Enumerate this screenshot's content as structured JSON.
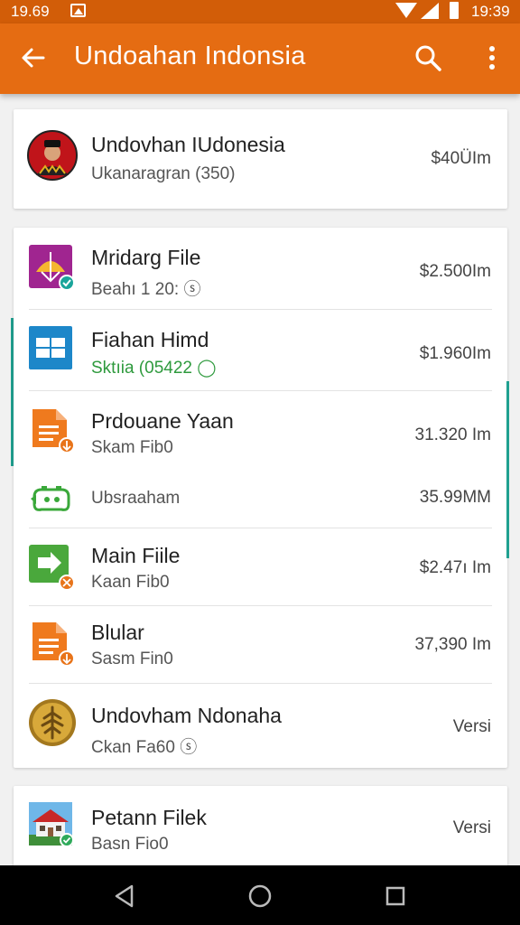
{
  "status_bar": {
    "time": "19.69",
    "clock": "19:39",
    "icons": [
      "notification-icon",
      "signal-icon",
      "network-icon",
      "battery-icon"
    ]
  },
  "app_bar": {
    "title": "Undoahan Indonsia",
    "icons": [
      "back-arrow-icon",
      "search-icon",
      "more-vert-icon"
    ]
  },
  "header_card": {
    "title": "Undovhan IUdonesia",
    "subtitle": "Ukanaragran (350)",
    "size": "$40ÜIm",
    "icon": "avatar-icon"
  },
  "file_list": [
    {
      "title": "Mridarg File",
      "subtitle": "Beahı 1 20: ⓢ",
      "size": "$2.500Im",
      "icon": "mridarg-app-icon",
      "badge": "check-badge-icon",
      "subtitle_color": "#555555"
    },
    {
      "title": "Fiahan Himd",
      "subtitle": "Sktıia (05422 ◯",
      "size": "$1.960Im",
      "icon": "windows-app-icon",
      "badge": "",
      "subtitle_color": "#2e9a3d"
    },
    {
      "title": "Prdouane Yaan",
      "subtitle": "Skam Fib0",
      "size": "31.320 Im",
      "icon": "document-icon",
      "badge": "download-badge-icon",
      "subtitle_color": "#555555"
    },
    {
      "title": "",
      "subtitle": "Ubsraaham",
      "size": "35.99MM",
      "icon": "game-controller-icon",
      "badge": "",
      "subtitle_color": "#555555"
    },
    {
      "title": "Main Fiile",
      "subtitle": "Kaan Fib0",
      "size": "$2.47ı Im",
      "icon": "play-file-icon",
      "badge": "tools-badge-icon",
      "subtitle_color": "#555555"
    },
    {
      "title": "Blular",
      "subtitle": "Sasm Fin0",
      "size": "37,390 Im",
      "icon": "document-icon",
      "badge": "download-badge-icon",
      "subtitle_color": "#555555"
    },
    {
      "title": "Undovham Ndonaha",
      "subtitle": "Ckan Fa60 ⓢ",
      "size": "Versi",
      "icon": "gold-coin-icon",
      "badge": "",
      "subtitle_color": "#555555"
    }
  ],
  "bottom_card": {
    "title": "Petann Filek",
    "subtitle": "Basn Fio0",
    "size": "Versi",
    "icon": "house-photo-icon",
    "badge": "check-badge-icon"
  },
  "nav_bar": {
    "icons": [
      "back-triangle-icon",
      "home-circle-icon",
      "recents-square-icon"
    ]
  },
  "colors": {
    "status_bar": "#d25d08",
    "app_bar": "#e56c12",
    "accent_teal": "#20a090",
    "green_text": "#2e9a3d",
    "badge_teal": "#1aa59b",
    "badge_orange": "#e8741a"
  }
}
